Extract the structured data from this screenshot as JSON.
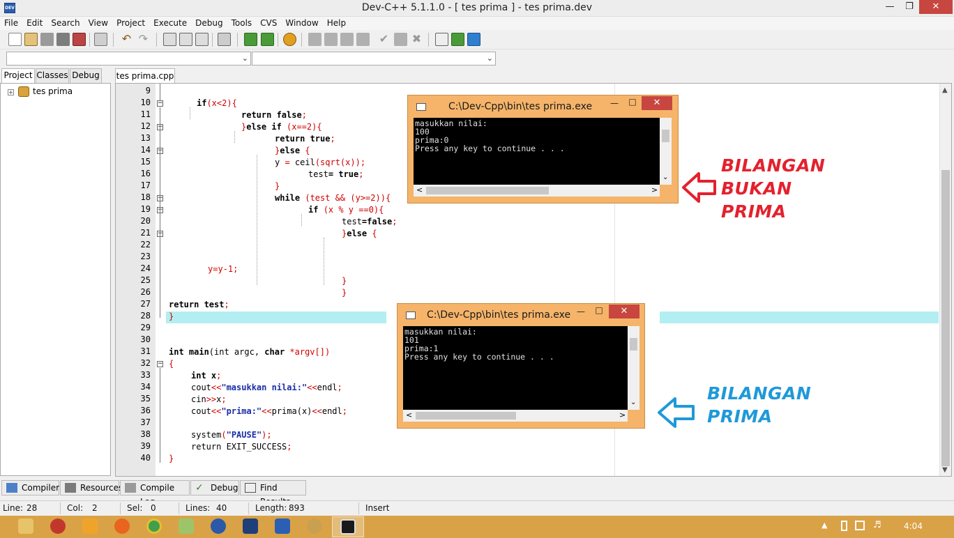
{
  "window": {
    "title": "Dev-C++ 5.1.1.0 - [ tes prima ] - tes prima.dev",
    "app_icon": "DEV"
  },
  "menu": [
    "File",
    "Edit",
    "Search",
    "View",
    "Project",
    "Execute",
    "Debug",
    "Tools",
    "CVS",
    "Window",
    "Help"
  ],
  "left_tabs": [
    "Project",
    "Classes",
    "Debug"
  ],
  "project_tree": {
    "root": "tes prima"
  },
  "editor_tab": "tes prima.cpp",
  "code_lines": [
    {
      "n": "9"
    },
    {
      "n": "10"
    },
    {
      "n": "11"
    },
    {
      "n": "12"
    },
    {
      "n": "13"
    },
    {
      "n": "14"
    },
    {
      "n": "15"
    },
    {
      "n": "16"
    },
    {
      "n": "17"
    },
    {
      "n": "18"
    },
    {
      "n": "19"
    },
    {
      "n": "20"
    },
    {
      "n": "21"
    },
    {
      "n": "22"
    },
    {
      "n": "23"
    },
    {
      "n": "24"
    },
    {
      "n": "25"
    },
    {
      "n": "26"
    },
    {
      "n": "27"
    },
    {
      "n": "28"
    },
    {
      "n": "29"
    },
    {
      "n": "30"
    },
    {
      "n": "31"
    },
    {
      "n": "32"
    },
    {
      "n": "33"
    },
    {
      "n": "34"
    },
    {
      "n": "35"
    },
    {
      "n": "36"
    },
    {
      "n": "37"
    },
    {
      "n": "38"
    },
    {
      "n": "39"
    },
    {
      "n": "40"
    }
  ],
  "code": {
    "l10": [
      "if",
      "(x<2){"
    ],
    "l11": [
      "return false",
      ";"
    ],
    "l12": [
      "}",
      "else if ",
      "(x==2){"
    ],
    "l13": [
      "return true",
      ";"
    ],
    "l14": [
      "}",
      "else ",
      "{"
    ],
    "l15": [
      "y ",
      "= ",
      "ceil",
      "(sqrt(x));"
    ],
    "l16": [
      "test",
      "= true",
      ";"
    ],
    "l17": [
      "}"
    ],
    "l18": [
      "while ",
      "(test && (y>=2)){"
    ],
    "l19": [
      "if ",
      "(x % y ==0){"
    ],
    "l20": [
      "test",
      "=false",
      ";"
    ],
    "l21": [
      "}",
      "else ",
      "{"
    ],
    "l24": [
      "y=y-1;"
    ],
    "l25": [
      "}"
    ],
    "l26": [
      "}"
    ],
    "l27": [
      "return test",
      ";"
    ],
    "l28": [
      "}"
    ],
    "l31": [
      "int main",
      "(int argc, ",
      "char ",
      "*argv[])"
    ],
    "l32": [
      "{"
    ],
    "l33": [
      "int x",
      ";"
    ],
    "l34": [
      "cout",
      "<<",
      "\"masukkan nilai:\"",
      "<<",
      "endl",
      ";"
    ],
    "l35": [
      "cin",
      ">>",
      "x",
      ";"
    ],
    "l36": [
      "cout",
      "<<",
      "\"prima:\"",
      "<<",
      "prima(x)",
      "<<",
      "endl",
      ";"
    ],
    "l38": [
      "system",
      "(",
      "\"PAUSE\"",
      ");"
    ],
    "l39": [
      "return EXIT_SUCCESS",
      ";"
    ],
    "l40": [
      "}"
    ]
  },
  "console1": {
    "title": "C:\\Dev-Cpp\\bin\\tes prima.exe",
    "lines": [
      "masukkan nilai:",
      "100",
      "prima:0",
      "Press any key to continue . . ."
    ]
  },
  "console2": {
    "title": "C:\\Dev-Cpp\\bin\\tes prima.exe",
    "lines": [
      "masukkan nilai:",
      "101",
      "prima:1",
      "Press any key to continue . . ."
    ]
  },
  "annotations": {
    "red": [
      "BILANGAN",
      "BUKAN",
      "PRIMA"
    ],
    "blue": [
      "BILANGAN",
      "PRIMA"
    ],
    "red_color": "#e4212d",
    "blue_color": "#1f99d9"
  },
  "bottom_tabs": [
    "Compiler",
    "Resources",
    "Compile Log",
    "Debug",
    "Find Results"
  ],
  "status": {
    "line_label": "Line:",
    "line": "28",
    "col_label": "Col:",
    "col": "2",
    "sel_label": "Sel:",
    "sel": "0",
    "lines_label": "Lines:",
    "lines": "40",
    "length_label": "Length:",
    "length": "893",
    "mode": "Insert"
  },
  "taskbar": {
    "clock": "4:04"
  },
  "colors": {
    "taskbar": "#d9a247",
    "console_frame": "#f5b46a",
    "line_highlight": "#b3eef2"
  }
}
